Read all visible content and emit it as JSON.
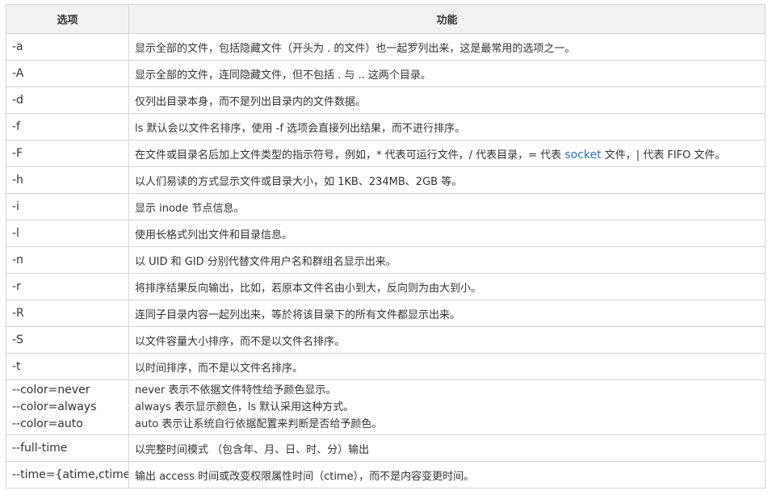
{
  "header": {
    "option": "选项",
    "function": "功能"
  },
  "rows": [
    {
      "option": "-a",
      "desc": "显示全部的文件，包括隐藏文件（开头为 . 的文件）也一起罗列出来，这是最常用的选项之一。"
    },
    {
      "option": "-A",
      "desc": "显示全部的文件，连同隐藏文件，但不包括 . 与 .. 这两个目录。"
    },
    {
      "option": "-d",
      "desc": "仅列出目录本身，而不是列出目录内的文件数据。"
    },
    {
      "option": "-f",
      "desc": "ls 默认会以文件名排序，使用 -f 选项会直接列出结果，而不进行排序。"
    },
    {
      "option": "-F",
      "desc_before": "在文件或目录名后加上文件类型的指示符号，例如，* 代表可运行文件，/ 代表目录，= 代表 ",
      "desc_link": "socket",
      "desc_after": " 文件，| 代表 FIFO 文件。"
    },
    {
      "option": "-h",
      "desc": "以人们易读的方式显示文件或目录大小，如 1KB、234MB、2GB 等。"
    },
    {
      "option": "-i",
      "desc": "显示 inode 节点信息。"
    },
    {
      "option": "-l",
      "desc": "使用长格式列出文件和目录信息。"
    },
    {
      "option": "-n",
      "desc": "以 UID 和 GID 分别代替文件用户名和群组名显示出来。"
    },
    {
      "option": "-r",
      "desc": "将排序结果反向输出，比如，若原本文件名由小到大，反向则为由大到小。"
    },
    {
      "option": "-R",
      "desc": "连同子目录内容一起列出来，等於将该目录下的所有文件都显示出来。"
    },
    {
      "option": "-S",
      "desc": "以文件容量大小排序，而不是以文件名排序。"
    },
    {
      "option": "-t",
      "desc": "以时间排序，而不是以文件名排序。"
    },
    {
      "options": [
        "--color=never",
        "--color=always",
        "--color=auto"
      ],
      "descs": [
        "never 表示不依据文件特性给予颜色显示。",
        "always 表示显示颜色，ls 默认采用这种方式。",
        "auto 表示让系统自行依据配置来判断是否给予颜色。"
      ]
    },
    {
      "option": "--full-time",
      "desc": "以完整时间模式 （包含年、月、日、时、分）输出"
    },
    {
      "option": "--time={atime,ctime}",
      "desc": "输出 access 时间或改变权限属性时间（ctime），而不是内容变更时间。"
    }
  ]
}
